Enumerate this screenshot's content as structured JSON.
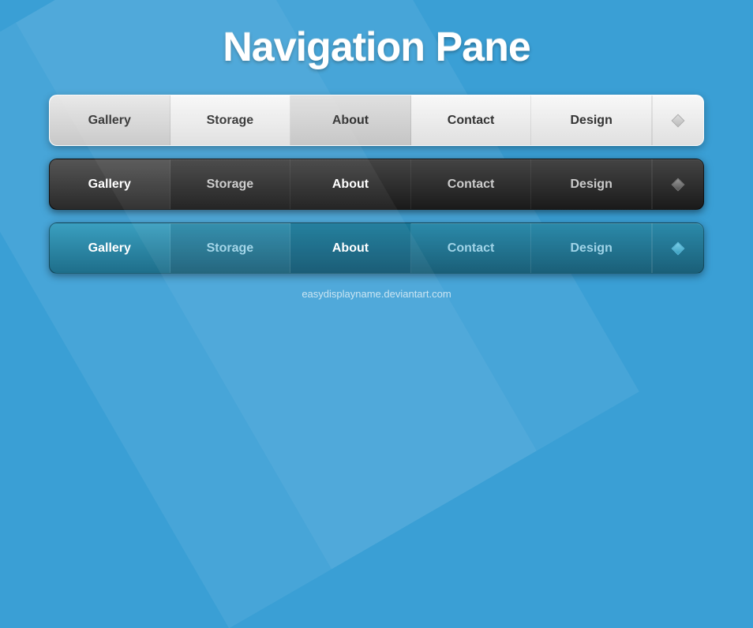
{
  "title": "Navigation Pane",
  "footer": "easydisplayname.deviantart.com",
  "nav_white": {
    "items": [
      "Gallery",
      "Storage",
      "About",
      "Contact",
      "Design"
    ],
    "active_index": 2
  },
  "nav_dark": {
    "items": [
      "Gallery",
      "Storage",
      "About",
      "Contact",
      "Design"
    ],
    "active_index": 2
  },
  "nav_teal": {
    "items": [
      "Gallery",
      "Storage",
      "About",
      "Contact",
      "Design"
    ],
    "active_index": 2
  }
}
